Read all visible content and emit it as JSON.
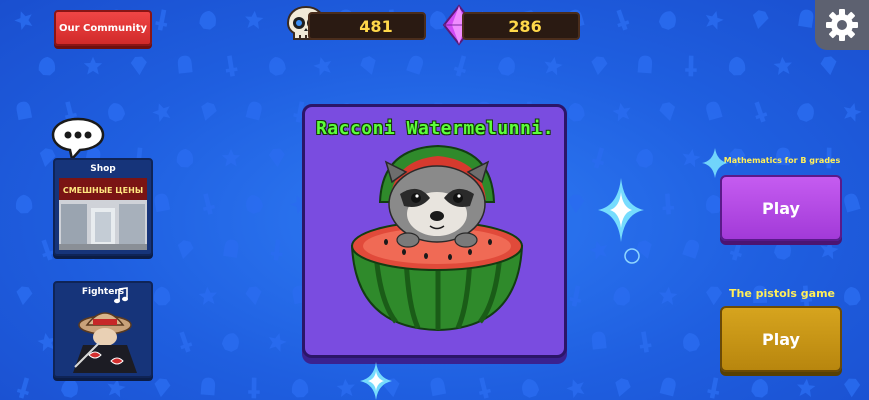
{
  "header": {
    "community_label": "Our Community",
    "skulls": "481",
    "gems": "286"
  },
  "left": {
    "shop_label": "Shop",
    "shop_sign_text": "СМЕШНЫЕ ЦЕНЫ",
    "fighters_label": "Fighters"
  },
  "card": {
    "title": "Racconi Watermelunni."
  },
  "right": {
    "mode1_title": "Mathematics for B grades",
    "mode1_button": "Play",
    "mode2_title": "The pistols game",
    "mode2_button": "Play"
  },
  "icons": [
    "skull-icon",
    "gem-icon",
    "gear-icon",
    "chat-bubble-icon",
    "music-note-icon",
    "sparkle-icon"
  ],
  "colors": {
    "background": "#1f5fe0",
    "community_button": "#e23a3a",
    "card": "#7a4ce0",
    "title_green": "#5cff3a",
    "label_yellow": "#ffef5a",
    "play_purple": "#b449e6",
    "play_gold": "#c9960f",
    "currency_text": "#ffd84a"
  }
}
